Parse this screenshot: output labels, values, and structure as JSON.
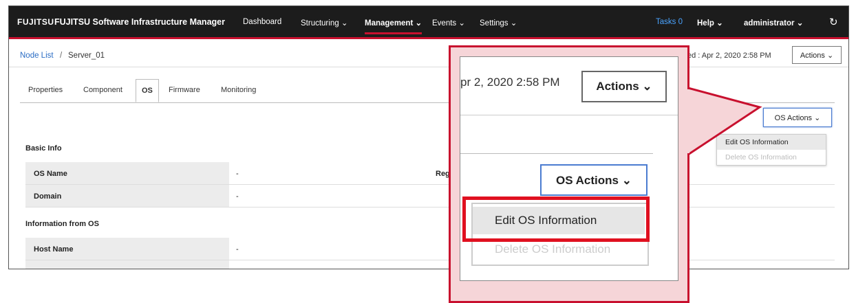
{
  "nav": {
    "logo": "FUJITSU",
    "app_name": "FUJITSU Software Infrastructure Manager",
    "menus": [
      "Dashboard",
      "Structuring",
      "Management",
      "Events",
      "Settings"
    ],
    "tasks": "Tasks 0",
    "help": "Help",
    "user": "administrator"
  },
  "breadcrumb": {
    "link": "Node List",
    "separator": "/",
    "current": "Server_01"
  },
  "header": {
    "updated": "ed : Apr 2, 2020 2:58 PM",
    "actions": "Actions"
  },
  "tabs": [
    "Properties",
    "Component",
    "OS",
    "Firmware",
    "Monitoring"
  ],
  "os_actions": {
    "button": "OS Actions",
    "items": [
      "Edit OS Information",
      "Delete OS Information"
    ]
  },
  "basic_info": {
    "title": "Basic Info",
    "rows": [
      {
        "label": "OS Name",
        "value": "-"
      },
      {
        "label": "Domain",
        "value": "-"
      }
    ],
    "side_label": "Reg"
  },
  "info_from_os": {
    "title": "Information from OS",
    "rows": [
      {
        "label": "Host Name",
        "value": "-"
      }
    ]
  },
  "zoom": {
    "date": "pr 2, 2020 2:58 PM",
    "actions": "Actions",
    "os_actions": "OS Actions",
    "edit": "Edit OS Information",
    "delete": "Delete OS Information"
  },
  "colors": {
    "accent_red": "#c8102e",
    "link_blue": "#2a6cc4",
    "nav_bg": "#1c1c1c"
  }
}
